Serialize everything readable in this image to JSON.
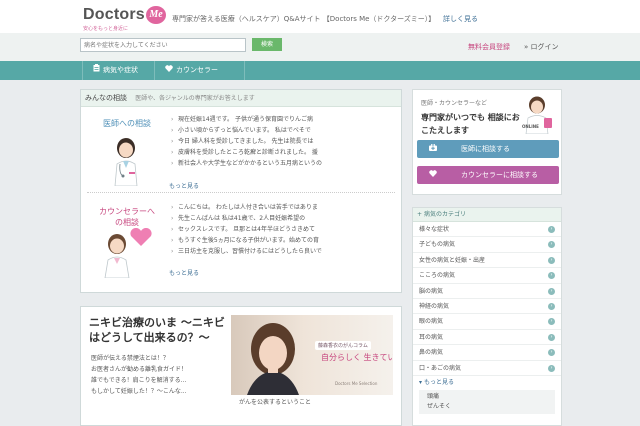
{
  "header": {
    "logo_text": "Doctors",
    "logo_badge": "Me",
    "logo_sub": "安心をもっと身近に",
    "tagline": "専門家が答える医療（ヘルスケア）Q&Aサイト 【Doctors Me（ドクターズミー）】",
    "tagline_more": "詳しく見る"
  },
  "search": {
    "placeholder": "病名や症状を入力してください",
    "button_label": "検索"
  },
  "account": {
    "register": "無料会員登録",
    "login": "ログイン"
  },
  "nav": {
    "items": [
      {
        "label": "病気や症状",
        "icon": "clipboard-icon"
      },
      {
        "label": "カウンセラー",
        "icon": "heart-icon"
      }
    ]
  },
  "qa": {
    "title": "みんなの相談",
    "subtitle": "医師や、各ジャンルの専門家がお答えします",
    "doctor_label": "医師への相談",
    "counselor_label": "カウンセラーへの相談",
    "doctor_questions": [
      "現在妊娠14週です。 子供が通う保育園でりんご病",
      "小さい頃からずっと悩んでいます。 私はでべそで",
      "今日 婦人科を受診してきました。 先生は院長では",
      "皮膚科を受診したところ乾癬と診断されました。 援",
      "新社会人や大学生などがかかるという五月病というの"
    ],
    "counselor_questions": [
      "こんにちは。 わたしは人付き合いは苦手ではありま",
      "先生こんばんは 私は41歳で、2人目妊娠希望の",
      "セックスレスです。 旦那とは4年半ほどうさきめて",
      "もうすぐ生後5ヵ月になる子供がいます。始めての育",
      "三日坊主を克服し、習慣付けるにはどうしたら良いで"
    ],
    "more_label": "もっと見る"
  },
  "feature": {
    "title": "ニキビ治療のいま 〜ニキビはどうして出来るの？〜",
    "items": [
      "医師が伝える禁煙法とは！？",
      "お医者さんが勧める離乳食ガイド！",
      "誰でもできる！肩こりを解消する...",
      "もしかして妊娠した！？〜こんな..."
    ],
    "photo_badge": "藤森香衣のがんコラム",
    "photo_quote": "自分らしく 生きていくために",
    "photo_credit": "Doctors Me Selection",
    "photo_caption": "がんを公表するということ"
  },
  "cta": {
    "head": "医師・カウンセラーなど",
    "main": "専門家がいつでも 相談におこたえします",
    "online_badge": "ONLINE",
    "doctor_button": "医師に相談する",
    "counselor_button": "カウンセラーに相談する"
  },
  "categories": {
    "title": "病気のカテゴリ",
    "items": [
      "様々な症状",
      "子どもの病気",
      "女性の病気と妊娠・出産",
      "こころの病気",
      "脳の病気",
      "神経の病気",
      "眼の病気",
      "耳の病気",
      "鼻の病気",
      "口・あごの病気"
    ],
    "more": "もっと見る",
    "sub_items": [
      "頭痛",
      "ぜんそく"
    ]
  },
  "colors": {
    "nav_teal": "#56a8a6",
    "brand_pink": "#e0659e",
    "doctor_blue": "#5f9cbb",
    "counselor_purple": "#b85ea4",
    "search_green": "#6ab86b"
  }
}
